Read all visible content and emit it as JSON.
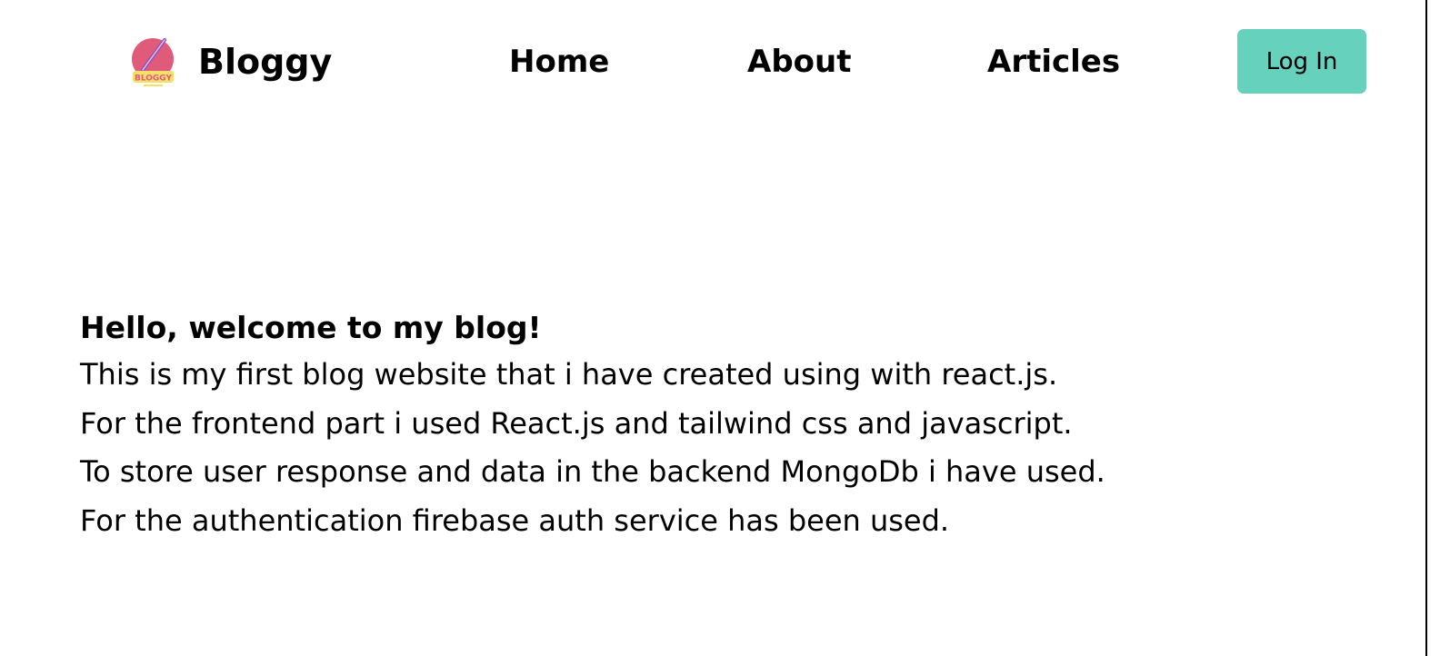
{
  "header": {
    "brand": {
      "logo_icon": "bloggy-logo-icon",
      "logo_text": "BLOGGY",
      "name": "Bloggy"
    },
    "nav": {
      "home": "Home",
      "about": "About",
      "articles": "Articles"
    },
    "login_label": "Log In"
  },
  "main": {
    "title": "Hello, welcome to my blog!",
    "paragraphs": [
      "This is my first blog website that i have created using with react.js.",
      "For the frontend part i used React.js and tailwind css and javascript.",
      "To store user response and data in the backend MongoDb i have used.",
      "For the authentication firebase auth service has been used."
    ]
  },
  "colors": {
    "accent": "#66d1bd",
    "logo_circle": "#e05a79",
    "logo_pencil": "#7a4fd6",
    "logo_banner": "#f4df6b"
  }
}
